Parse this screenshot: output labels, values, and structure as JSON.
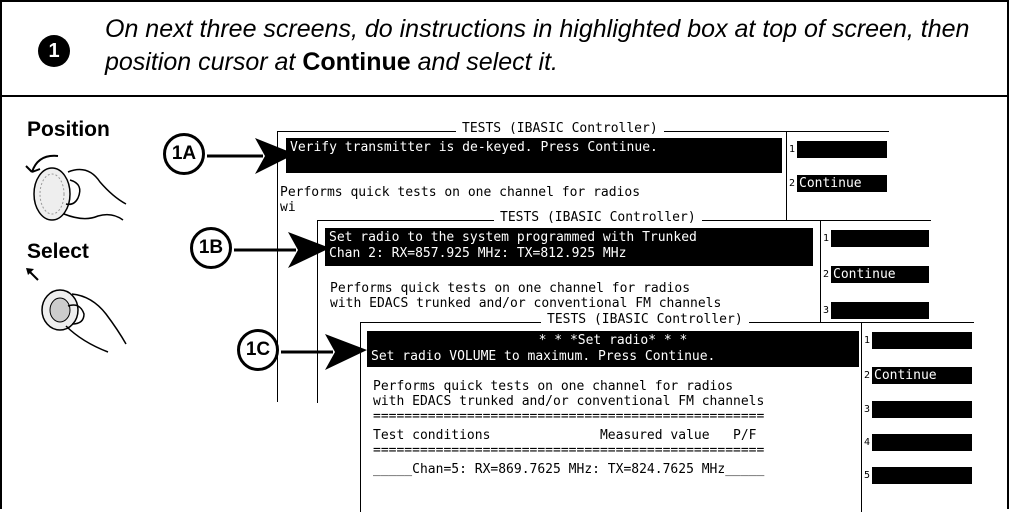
{
  "step": {
    "number": "1",
    "instruction_1": "On next three screens, do instructions in highlighted box at top of screen, then position cursor at ",
    "instruction_bold": "Continue",
    "instruction_2": " and select it."
  },
  "controls": {
    "position_label": "Position",
    "select_label": "Select"
  },
  "screens": [
    {
      "callout": "1A",
      "title": "TESTS (IBASIC Controller)",
      "highlight_lines": [
        "Verify transmitter is de-keyed. Press Continue."
      ],
      "body": "Performs quick tests on one channel for radios\nwi",
      "softkeys": [
        {
          "num": "1",
          "label": ""
        },
        {
          "num": "2",
          "label": "Continue"
        }
      ]
    },
    {
      "callout": "1B",
      "title": "TESTS (IBASIC Controller)",
      "highlight_lines": [
        "Set radio to the system programmed with Trunked",
        "Chan 2: RX=857.925 MHz: TX=812.925 MHz"
      ],
      "body": "Performs quick tests on one channel for radios\nwith EDACS trunked and/or conventional FM channels",
      "softkeys": [
        {
          "num": "1",
          "label": ""
        },
        {
          "num": "2",
          "label": "Continue"
        },
        {
          "num": "3",
          "label": ""
        }
      ]
    },
    {
      "callout": "1C",
      "title": "TESTS (IBASIC Controller)",
      "highlight_lines": [
        "* * *Set radio* * *",
        "Set radio VOLUME to maximum. Press Continue."
      ],
      "body_lines": [
        "Performs quick tests on one channel for radios",
        "with EDACS trunked and/or conventional FM channels",
        "==================================================",
        "Test conditions              Measured value   P/F",
        "==================================================",
        "_____Chan=5: RX=869.7625 MHz: TX=824.7625 MHz_____"
      ],
      "softkeys": [
        {
          "num": "1",
          "label": ""
        },
        {
          "num": "2",
          "label": "Continue"
        },
        {
          "num": "3",
          "label": ""
        },
        {
          "num": "4",
          "label": ""
        },
        {
          "num": "5",
          "label": ""
        }
      ]
    }
  ]
}
